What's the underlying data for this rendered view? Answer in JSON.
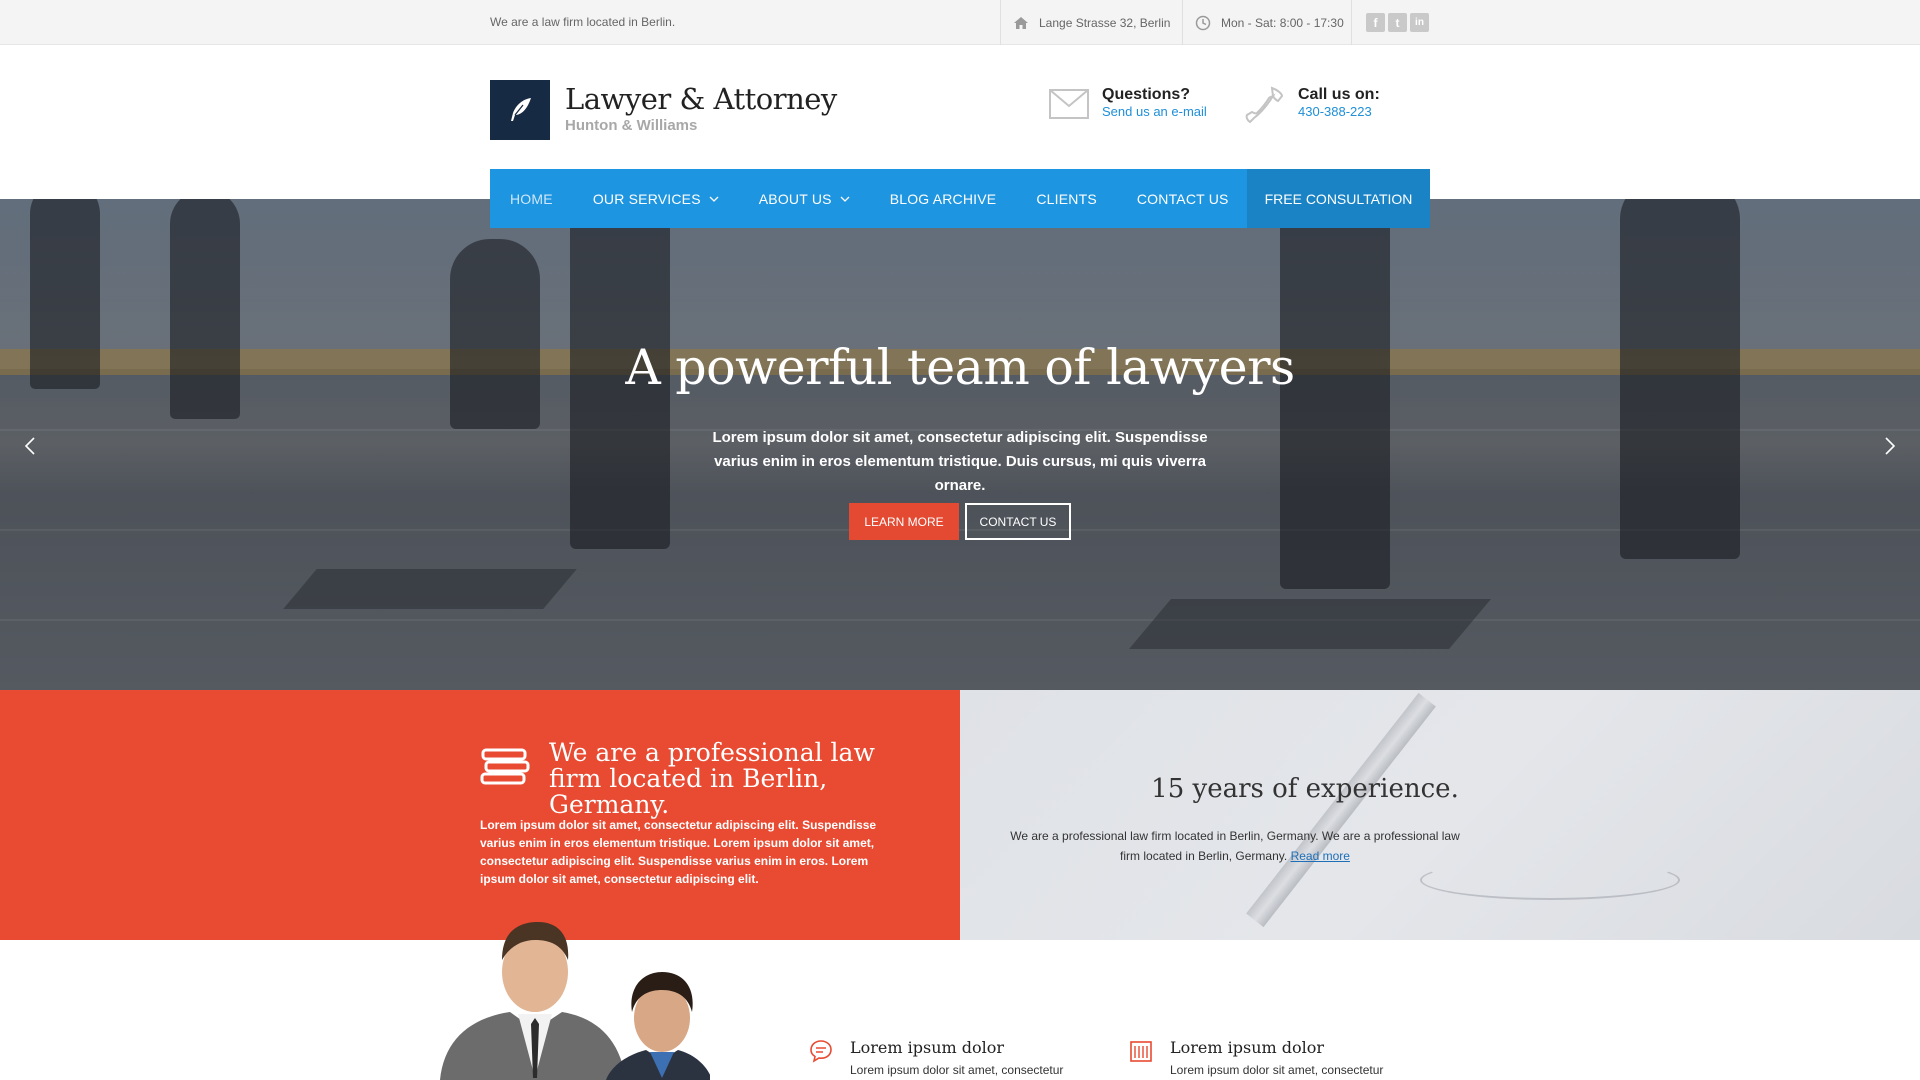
{
  "topbar": {
    "tagline": "We are a law firm located in Berlin.",
    "address": "Lange Strasse 32, Berlin",
    "hours": "Mon - Sat: 8:00 - 17:30",
    "social": [
      {
        "name": "facebook",
        "glyph": "f"
      },
      {
        "name": "twitter",
        "glyph": "t"
      },
      {
        "name": "linkedin",
        "glyph": "in"
      }
    ]
  },
  "header": {
    "brand_title": "Lawyer & Attorney",
    "brand_sub": "Hunton & Williams",
    "questions_label": "Questions?",
    "questions_link": "Send us an e-mail",
    "call_label": "Call us on:",
    "call_number": "430-388-223"
  },
  "nav": {
    "items": [
      {
        "label": "Home",
        "active": true,
        "dropdown": false
      },
      {
        "label": "Our Services",
        "active": false,
        "dropdown": true
      },
      {
        "label": "About Us",
        "active": false,
        "dropdown": true
      },
      {
        "label": "Blog Archive",
        "active": false,
        "dropdown": false
      },
      {
        "label": "Clients",
        "active": false,
        "dropdown": false
      },
      {
        "label": "Contact Us",
        "active": false,
        "dropdown": false
      }
    ],
    "cta": "Free Consultation"
  },
  "hero": {
    "title": "A powerful team of lawyers",
    "lead": "Lorem ipsum dolor sit amet, consectetur adipiscing elit. Suspendisse varius enim in eros elementum tristique. Duis cursus, mi quis viverra ornare.",
    "learn_more": "Learn More",
    "contact_us": "Contact Us"
  },
  "features": {
    "left_title": "We are a professional law firm located in Berlin, Germany.",
    "left_text": "Lorem ipsum dolor sit amet, consectetur adipiscing elit. Suspendisse varius enim in eros elementum tristique. Lorem ipsum dolor sit amet, consectetur adipiscing elit. Suspendisse varius enim in eros. Lorem ipsum dolor sit amet, consectetur adipiscing elit.",
    "right_title": "15 years of experience.",
    "right_text": "We are a professional law firm located in Berlin, Germany. We are a professional law firm located in Berlin, Germany.",
    "read_more": "Read more"
  },
  "services": [
    {
      "icon": "speech-bubble-icon",
      "title": "Lorem ipsum dolor",
      "text": "Lorem ipsum dolor sit amet, consectetur"
    },
    {
      "icon": "building-icon",
      "title": "Lorem ipsum dolor",
      "text": "Lorem ipsum dolor sit amet, consectetur"
    }
  ],
  "colors": {
    "nav_blue": "#1e95e0",
    "cta_blue": "#1983c6",
    "accent_red": "#e84a32",
    "logo_navy": "#172a44"
  }
}
